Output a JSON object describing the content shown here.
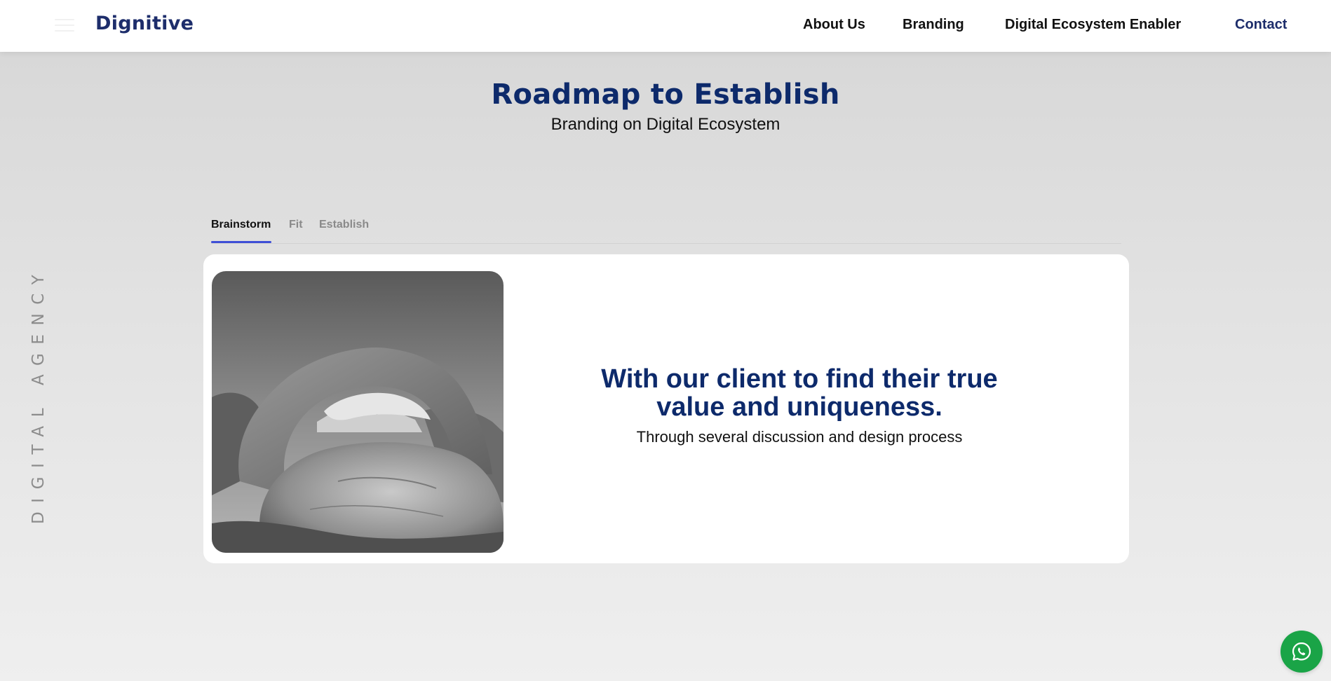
{
  "header": {
    "brand": "Dignitive",
    "nav": [
      {
        "label": "About Us"
      },
      {
        "label": "Branding"
      },
      {
        "label": "Digital Ecosystem Enabler"
      },
      {
        "label": "Contact"
      }
    ],
    "menu_icon": "hamburger-icon"
  },
  "hero": {
    "title": "Roadmap to Establish",
    "subtitle": "Branding on Digital Ecosystem"
  },
  "side_label": "DIGITAL AGENCY",
  "tabs": {
    "active": "Brainstorm",
    "items": [
      {
        "label": "Brainstorm"
      },
      {
        "label": "Fit"
      },
      {
        "label": "Establish"
      }
    ]
  },
  "card": {
    "image_subject": "black-and-white rock arch photo",
    "heading": "With our client to find their true value and uniqueness.",
    "text": "Through several discussion and design process"
  },
  "floating": {
    "icon": "whatsapp-icon"
  },
  "colors": {
    "brand": "#1d2d6b",
    "title": "#0d2a6b",
    "tab_indicator": "#3e4fd6",
    "whatsapp": "#1aa447"
  }
}
